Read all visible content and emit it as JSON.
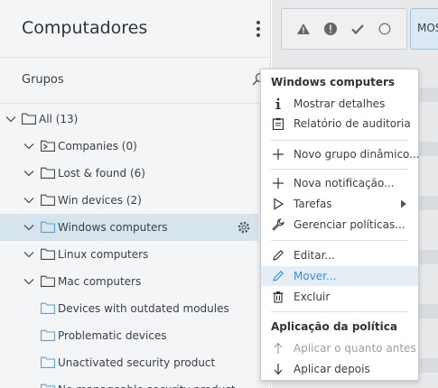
{
  "panel": {
    "title": "Computadores",
    "groups_label": "Grupos"
  },
  "tree": [
    {
      "label": "All (13)",
      "level": 0,
      "expanded": true,
      "selected": false
    },
    {
      "label": "Companies (0)",
      "level": 1,
      "expanded": true,
      "selected": false
    },
    {
      "label": "Lost & found (6)",
      "level": 1,
      "expanded": true,
      "selected": false
    },
    {
      "label": "Win devices (2)",
      "level": 1,
      "expanded": true,
      "selected": false
    },
    {
      "label": "Windows computers",
      "level": 1,
      "expanded": true,
      "selected": true
    },
    {
      "label": "Linux computers",
      "level": 1,
      "expanded": true,
      "selected": false
    },
    {
      "label": "Mac computers",
      "level": 1,
      "expanded": true,
      "selected": false
    },
    {
      "label": "Devices with outdated modules",
      "level": 2,
      "selected": false
    },
    {
      "label": "Problematic devices",
      "level": 2,
      "selected": false
    },
    {
      "label": "Unactivated security product",
      "level": 2,
      "selected": false
    },
    {
      "label": "No manageable security product",
      "level": 2,
      "selected": false
    }
  ],
  "toolbar": {
    "status_icons": [
      "warning-icon",
      "error-icon",
      "check-icon",
      "circle-icon"
    ],
    "mos_label": "MOS"
  },
  "context_menu": {
    "section1_title": "Windows computers",
    "section2_title": "Aplicação da política",
    "items": {
      "show_details": "Mostrar detalhes",
      "audit_report": "Relatório de auditoria",
      "new_dynamic_group": "Novo grupo dinâmico...",
      "new_notification": "Nova notificação...",
      "tasks": "Tarefas",
      "manage_policies": "Gerenciar políticas...",
      "edit": "Editar...",
      "move": "Mover...",
      "delete": "Excluir",
      "apply_asap": "Aplicar o quanto antes",
      "apply_later": "Aplicar depois"
    }
  },
  "colors": {
    "selected_row": "#d6e4ee",
    "hover_item": "#e5eef6",
    "folder_blue": "#5aa0d6",
    "accent_blue": "#3d8ccf"
  }
}
